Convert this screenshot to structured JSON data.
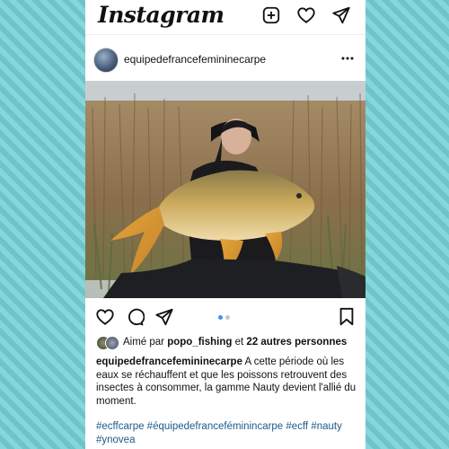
{
  "app": {
    "title": "Instagram"
  },
  "topbar": {
    "icons": [
      "add-post-icon",
      "heart-icon",
      "send-icon"
    ]
  },
  "post": {
    "username": "equipedefrancefemininecarpe",
    "likes": {
      "prefix": "Aimé par",
      "user": "popo_fishing",
      "middle": "et",
      "others": "22 autres personnes"
    },
    "caption": {
      "username": "equipedefrancefemininecarpe",
      "text": "A cette période où les eaux se réchauffent et que les poissons retrouvent des insectes à consommer, la gamme Nauty devient l'allié du moment."
    },
    "hashtags": "#ecffcarpe #équipedefranceféminincarpe #ecff #nauty #ynovea",
    "carousel": {
      "count": 2,
      "active": 1
    }
  },
  "colors": {
    "link": "#1d5a8a",
    "dot_active": "#3897f0",
    "background": "#7ccfd3"
  }
}
